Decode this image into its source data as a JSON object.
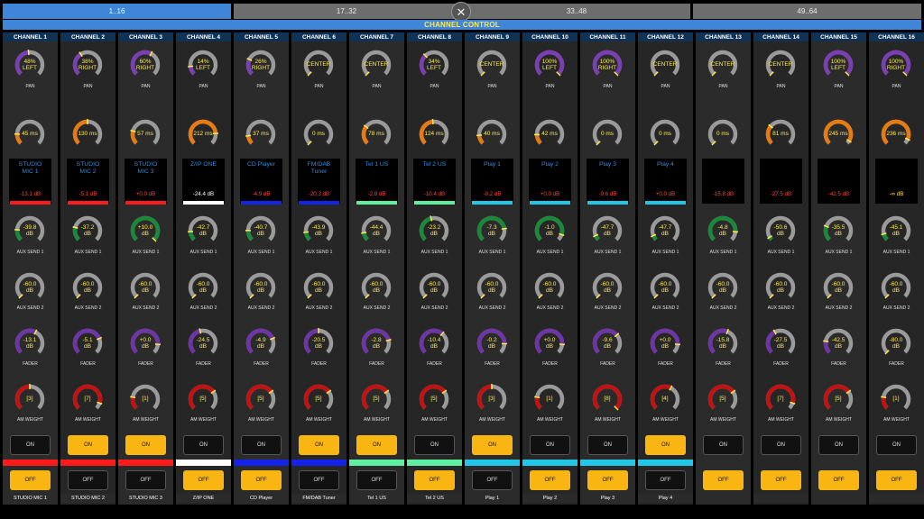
{
  "tabs": [
    {
      "label": "1..16",
      "active": true
    },
    {
      "label": "17..32",
      "active": false
    },
    {
      "label": "33..48",
      "active": false
    },
    {
      "label": "49..64",
      "active": false
    }
  ],
  "close_symbol": "✕",
  "header_title": "CHANNEL CONTROL",
  "labels": {
    "pan": "PAN",
    "delay": "",
    "aux1": "AUX SEND 1",
    "aux2": "AUX SEND 2",
    "fader": "FADER",
    "am": "AM WEIGHT",
    "on": "ON",
    "off": "OFF"
  },
  "colors": {
    "accent": "#3f86d8",
    "value_text": "#ffe94d",
    "on_button": "#f9b612",
    "knob_track": "#9a9a9a"
  },
  "channels": [
    {
      "title": "CHANNEL 1",
      "pan": {
        "line1": "48%",
        "line2": "LEFT",
        "frac": 0.48,
        "color": "#7b3fb5"
      },
      "delay": {
        "text": "45 ms",
        "frac": 0.17
      },
      "name": "STUDIO\nMIC 1",
      "db": "-13.1 dB",
      "dbclass": "",
      "bar": "#ff1b1b",
      "aux1": {
        "line1": "-39.8",
        "line2": "dB",
        "frac": 0.18
      },
      "aux2": {
        "line1": "-60.0",
        "line2": "dB",
        "frac": 0.0
      },
      "fader": {
        "line1": "-13.1",
        "line2": "dB",
        "frac": 0.6
      },
      "am": {
        "text": "[3]",
        "frac": 0.5
      },
      "on": false,
      "footer": "STUDIO MIC 1"
    },
    {
      "title": "CHANNEL 2",
      "pan": {
        "line1": "38%",
        "line2": "RIGHT",
        "frac": 0.38,
        "color": "#7b3fb5"
      },
      "delay": {
        "text": "130 ms",
        "frac": 0.5
      },
      "name": "STUDIO\nMIC 2",
      "db": "-5.1 dB",
      "dbclass": "",
      "bar": "#ff1b1b",
      "aux1": {
        "line1": "-37.2",
        "line2": "dB",
        "frac": 0.22
      },
      "aux2": {
        "line1": "-60.0",
        "line2": "dB",
        "frac": 0.0
      },
      "fader": {
        "line1": "-5.1",
        "line2": "dB",
        "frac": 0.75
      },
      "am": {
        "text": "[7]",
        "frac": 0.9
      },
      "on": true,
      "footer": "STUDIO MIC 2"
    },
    {
      "title": "CHANNEL 3",
      "pan": {
        "line1": "60%",
        "line2": "RIGHT",
        "frac": 0.6,
        "color": "#7b3fb5"
      },
      "delay": {
        "text": "57 ms",
        "frac": 0.22
      },
      "name": "STUDIO\nMIC 3",
      "db": "+0.0 dB",
      "dbclass": "",
      "bar": "#ff1b1b",
      "aux1": {
        "line1": "+10.0",
        "line2": "dB",
        "frac": 1.0
      },
      "aux2": {
        "line1": "-60.0",
        "line2": "dB",
        "frac": 0.0
      },
      "fader": {
        "line1": "+0.0",
        "line2": "dB",
        "frac": 0.85
      },
      "am": {
        "text": "[1]",
        "frac": 0.2
      },
      "on": true,
      "footer": "STUDIO MIC 3"
    },
    {
      "title": "CHANNEL 4",
      "pan": {
        "line1": "14%",
        "line2": "LEFT",
        "frac": 0.14,
        "color": "#7b3fb5"
      },
      "delay": {
        "text": "212 ms",
        "frac": 0.82
      },
      "name": "Z/IP ONE",
      "db": "-24.4 dB",
      "dbclass": "white",
      "bar": "#ffffff",
      "aux1": {
        "line1": "-42.7",
        "line2": "dB",
        "frac": 0.15
      },
      "aux2": {
        "line1": "-60.0",
        "line2": "dB",
        "frac": 0.0
      },
      "fader": {
        "line1": "-24.5",
        "line2": "dB",
        "frac": 0.45
      },
      "am": {
        "text": "[5]",
        "frac": 0.7
      },
      "on": false,
      "footer": "Z/IP ONE"
    },
    {
      "title": "CHANNEL 5",
      "pan": {
        "line1": "26%",
        "line2": "RIGHT",
        "frac": 0.26,
        "color": "#7b3fb5"
      },
      "delay": {
        "text": "37 ms",
        "frac": 0.14
      },
      "name": "CD Player",
      "db": "-4.9 dB",
      "dbclass": "",
      "bar": "#1522e8",
      "aux1": {
        "line1": "-40.7",
        "line2": "dB",
        "frac": 0.17
      },
      "aux2": {
        "line1": "-60.0",
        "line2": "dB",
        "frac": 0.0
      },
      "fader": {
        "line1": "-4.9",
        "line2": "dB",
        "frac": 0.75
      },
      "am": {
        "text": "[5]",
        "frac": 0.7
      },
      "on": false,
      "footer": "CD Player"
    },
    {
      "title": "CHANNEL 6",
      "pan": {
        "line1": "CENTER",
        "line2": "",
        "frac": 0.0,
        "color": "#7b3fb5"
      },
      "delay": {
        "text": "0 ms",
        "frac": 0.0
      },
      "name": "FM/DAB\nTuner",
      "db": "-20.3 dB",
      "dbclass": "",
      "bar": "#1522e8",
      "aux1": {
        "line1": "-43.9",
        "line2": "dB",
        "frac": 0.14
      },
      "aux2": {
        "line1": "-60.0",
        "line2": "dB",
        "frac": 0.0
      },
      "fader": {
        "line1": "-20.5",
        "line2": "dB",
        "frac": 0.5
      },
      "am": {
        "text": "[5]",
        "frac": 0.7
      },
      "on": true,
      "footer": "FM/DAB Tuner"
    },
    {
      "title": "CHANNEL 7",
      "pan": {
        "line1": "CENTER",
        "line2": "",
        "frac": 0.0,
        "color": "#7b3fb5"
      },
      "delay": {
        "text": "78 ms",
        "frac": 0.3
      },
      "name": "Tel 1 US",
      "db": "-2.8 dB",
      "dbclass": "",
      "bar": "#5ef0a0",
      "aux1": {
        "line1": "-44.4",
        "line2": "dB",
        "frac": 0.13
      },
      "aux2": {
        "line1": "-60.0",
        "line2": "dB",
        "frac": 0.0
      },
      "fader": {
        "line1": "-2.8",
        "line2": "dB",
        "frac": 0.78
      },
      "am": {
        "text": "[5]",
        "frac": 0.7
      },
      "on": true,
      "footer": "Tel 1 US"
    },
    {
      "title": "CHANNEL 8",
      "pan": {
        "line1": "34%",
        "line2": "LEFT",
        "frac": 0.34,
        "color": "#7b3fb5"
      },
      "delay": {
        "text": "124 ms",
        "frac": 0.48
      },
      "name": "Tel 2 US",
      "db": "-10.4 dB",
      "dbclass": "",
      "bar": "#5ef0a0",
      "aux1": {
        "line1": "-23.2",
        "line2": "dB",
        "frac": 0.45
      },
      "aux2": {
        "line1": "-60.0",
        "line2": "dB",
        "frac": 0.0
      },
      "fader": {
        "line1": "-10.4",
        "line2": "dB",
        "frac": 0.65
      },
      "am": {
        "text": "[5]",
        "frac": 0.7
      },
      "on": false,
      "footer": "Tel 2 US"
    },
    {
      "title": "CHANNEL 9",
      "pan": {
        "line1": "CENTER",
        "line2": "",
        "frac": 0.0,
        "color": "#7b3fb5"
      },
      "delay": {
        "text": "40 ms",
        "frac": 0.15
      },
      "name": "Play 1",
      "db": "-0.2 dB",
      "dbclass": "",
      "bar": "#22c7e8",
      "aux1": {
        "line1": "-7.3",
        "line2": "dB",
        "frac": 0.8
      },
      "aux2": {
        "line1": "-60.0",
        "line2": "dB",
        "frac": 0.0
      },
      "fader": {
        "line1": "-0.2",
        "line2": "dB",
        "frac": 0.84
      },
      "am": {
        "text": "[3]",
        "frac": 0.5
      },
      "on": true,
      "footer": "Play 1"
    },
    {
      "title": "CHANNEL 10",
      "pan": {
        "line1": "100%",
        "line2": "LEFT",
        "frac": 1.0,
        "color": "#7b3fb5"
      },
      "delay": {
        "text": "42 ms",
        "frac": 0.16
      },
      "name": "Play 2",
      "db": "+0.0 dB",
      "dbclass": "",
      "bar": "#22c7e8",
      "aux1": {
        "line1": "-1.0",
        "line2": "dB",
        "frac": 0.9
      },
      "aux2": {
        "line1": "-60.0",
        "line2": "dB",
        "frac": 0.0
      },
      "fader": {
        "line1": "+0.0",
        "line2": "dB",
        "frac": 0.85
      },
      "am": {
        "text": "[1]",
        "frac": 0.2
      },
      "on": false,
      "footer": "Play 2"
    },
    {
      "title": "CHANNEL 11",
      "pan": {
        "line1": "100%",
        "line2": "RIGHT",
        "frac": 1.0,
        "color": "#7b3fb5"
      },
      "delay": {
        "text": "0 ms",
        "frac": 0.0
      },
      "name": "Play 3",
      "db": "-9.6 dB",
      "dbclass": "",
      "bar": "#22c7e8",
      "aux1": {
        "line1": "-47.7",
        "line2": "dB",
        "frac": 0.08
      },
      "aux2": {
        "line1": "-60.0",
        "line2": "dB",
        "frac": 0.0
      },
      "fader": {
        "line1": "-9.6",
        "line2": "dB",
        "frac": 0.68
      },
      "am": {
        "text": "[8]",
        "frac": 1.0
      },
      "on": false,
      "footer": "Play 3"
    },
    {
      "title": "CHANNEL 12",
      "pan": {
        "line1": "CENTER",
        "line2": "",
        "frac": 0.0,
        "color": "#7b3fb5"
      },
      "delay": {
        "text": "0 ms",
        "frac": 0.0
      },
      "name": "Play 4",
      "db": "+0.0 dB",
      "dbclass": "",
      "bar": "#22c7e8",
      "aux1": {
        "line1": "-47.7",
        "line2": "dB",
        "frac": 0.08
      },
      "aux2": {
        "line1": "-60.0",
        "line2": "dB",
        "frac": 0.0
      },
      "fader": {
        "line1": "+0.0",
        "line2": "dB",
        "frac": 0.85
      },
      "am": {
        "text": "[4]",
        "frac": 0.6
      },
      "on": true,
      "footer": "Play 4"
    },
    {
      "title": "CHANNEL 13",
      "pan": {
        "line1": "CENTER",
        "line2": "",
        "frac": 0.0,
        "color": "#7b3fb5"
      },
      "delay": {
        "text": "0 ms",
        "frac": 0.0
      },
      "name": "",
      "db": "-15.8 dB",
      "dbclass": "",
      "bar": "",
      "aux1": {
        "line1": "-4.8",
        "line2": "dB",
        "frac": 0.85
      },
      "aux2": {
        "line1": "-60.0",
        "line2": "dB",
        "frac": 0.0
      },
      "fader": {
        "line1": "-15.8",
        "line2": "dB",
        "frac": 0.58
      },
      "am": {
        "text": "[5]",
        "frac": 0.7
      },
      "on": false,
      "footer": ""
    },
    {
      "title": "CHANNEL 14",
      "pan": {
        "line1": "CENTER",
        "line2": "",
        "frac": 0.0,
        "color": "#7b3fb5"
      },
      "delay": {
        "text": "81 ms",
        "frac": 0.31
      },
      "name": "",
      "db": "-27.5 dB",
      "dbclass": "",
      "bar": "",
      "aux1": {
        "line1": "-50.6",
        "line2": "dB",
        "frac": 0.05
      },
      "aux2": {
        "line1": "-60.0",
        "line2": "dB",
        "frac": 0.0
      },
      "fader": {
        "line1": "-27.5",
        "line2": "dB",
        "frac": 0.4
      },
      "am": {
        "text": "[7]",
        "frac": 0.9
      },
      "on": false,
      "footer": ""
    },
    {
      "title": "CHANNEL 15",
      "pan": {
        "line1": "100%",
        "line2": "LEFT",
        "frac": 1.0,
        "color": "#7b3fb5"
      },
      "delay": {
        "text": "245 ms",
        "frac": 0.95
      },
      "name": "",
      "db": "-42.5 dB",
      "dbclass": "",
      "bar": "",
      "aux1": {
        "line1": "-35.5",
        "line2": "dB",
        "frac": 0.24
      },
      "aux2": {
        "line1": "-60.0",
        "line2": "dB",
        "frac": 0.0
      },
      "fader": {
        "line1": "-42.5",
        "line2": "dB",
        "frac": 0.2
      },
      "am": {
        "text": "[5]",
        "frac": 0.7
      },
      "on": false,
      "footer": ""
    },
    {
      "title": "CHANNEL 16",
      "pan": {
        "line1": "100%",
        "line2": "RIGHT",
        "frac": 1.0,
        "color": "#7b3fb5"
      },
      "delay": {
        "text": "236 ms",
        "frac": 0.92
      },
      "name": "",
      "db": "-∞ dB",
      "dbclass": "neutral",
      "bar": "",
      "aux1": {
        "line1": "-45.1",
        "line2": "dB",
        "frac": 0.11
      },
      "aux2": {
        "line1": "-60.0",
        "line2": "dB",
        "frac": 0.0
      },
      "fader": {
        "line1": "-80.0",
        "line2": "dB",
        "frac": 0.0
      },
      "am": {
        "text": "[1]",
        "frac": 0.2
      },
      "on": false,
      "footer": ""
    }
  ]
}
